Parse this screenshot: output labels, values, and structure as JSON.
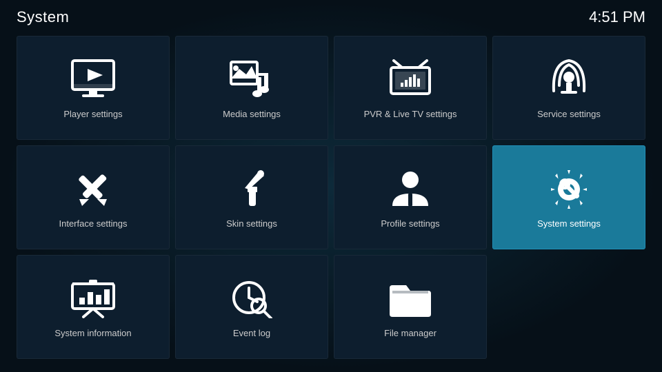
{
  "header": {
    "title": "System",
    "time": "4:51 PM"
  },
  "grid": {
    "items": [
      {
        "id": "player-settings",
        "label": "Player settings",
        "icon": "player",
        "active": false
      },
      {
        "id": "media-settings",
        "label": "Media settings",
        "icon": "media",
        "active": false
      },
      {
        "id": "pvr-settings",
        "label": "PVR & Live TV settings",
        "icon": "pvr",
        "active": false
      },
      {
        "id": "service-settings",
        "label": "Service settings",
        "icon": "service",
        "active": false
      },
      {
        "id": "interface-settings",
        "label": "Interface settings",
        "icon": "interface",
        "active": false
      },
      {
        "id": "skin-settings",
        "label": "Skin settings",
        "icon": "skin",
        "active": false
      },
      {
        "id": "profile-settings",
        "label": "Profile settings",
        "icon": "profile",
        "active": false
      },
      {
        "id": "system-settings",
        "label": "System settings",
        "icon": "system",
        "active": true
      },
      {
        "id": "system-information",
        "label": "System information",
        "icon": "sysinfo",
        "active": false
      },
      {
        "id": "event-log",
        "label": "Event log",
        "icon": "eventlog",
        "active": false
      },
      {
        "id": "file-manager",
        "label": "File manager",
        "icon": "filemanager",
        "active": false
      }
    ]
  }
}
